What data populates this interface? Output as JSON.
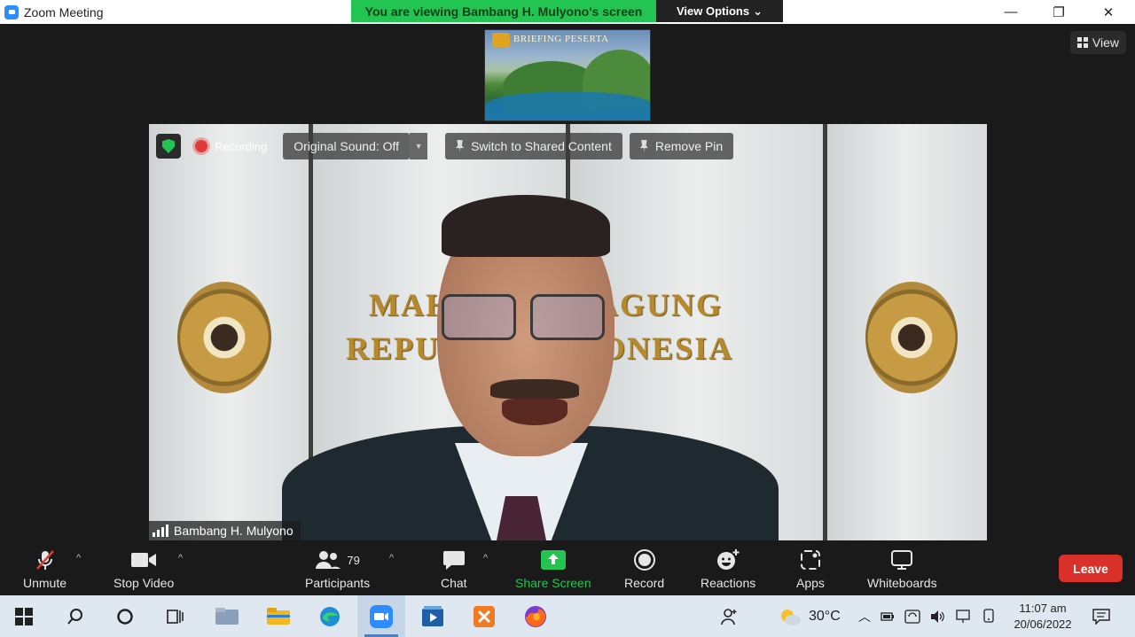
{
  "window": {
    "title": "Zoom Meeting",
    "banner": "You are viewing Bambang H. Mulyono's screen",
    "view_options": "View Options",
    "minimize": "—",
    "maximize": "❐",
    "close": "✕"
  },
  "meeting": {
    "view_label": "View",
    "thumbnail_title": "BRIEFING PESERTA",
    "wall_text_line1": "MAHKAMAH AGUNG",
    "wall_text_line2": "REPUBLIK INDONESIA",
    "recording_label": "Recording",
    "original_sound": "Original Sound: Off",
    "switch_shared": "Switch to Shared Content",
    "remove_pin": "Remove Pin",
    "speaker_name": "Bambang H. Mulyono"
  },
  "controls": {
    "unmute": "Unmute",
    "stop_video": "Stop Video",
    "participants": "Participants",
    "participants_count": "79",
    "chat": "Chat",
    "share_screen": "Share Screen",
    "record": "Record",
    "reactions": "Reactions",
    "apps": "Apps",
    "whiteboards": "Whiteboards",
    "leave": "Leave"
  },
  "taskbar": {
    "temperature": "30°C",
    "time": "11:07 am",
    "date": "20/06/2022"
  },
  "colors": {
    "zoom_green": "#23c552",
    "leave_red": "#d9302a",
    "zoom_blue": "#2d8cff"
  }
}
